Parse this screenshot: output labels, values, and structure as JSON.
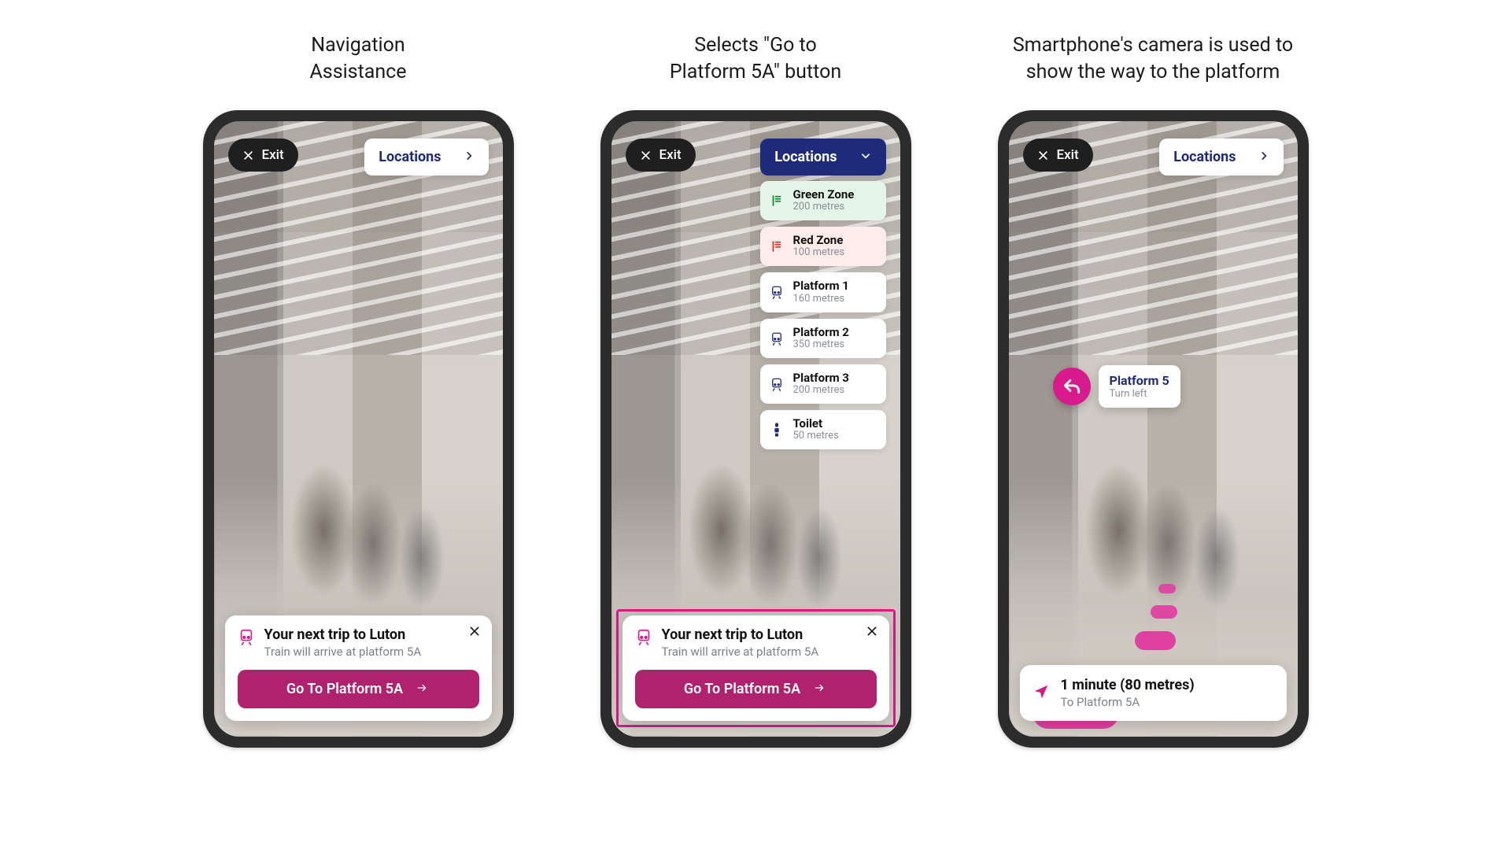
{
  "captions": {
    "c1": "Navigation\nAssistance",
    "c2": "Selects \"Go to\nPlatform 5A\" button",
    "c3": "Smartphone's camera is used to\nshow the way to the platform"
  },
  "top": {
    "exit": "Exit",
    "locations": "Locations"
  },
  "trip": {
    "title": "Your next trip to Luton",
    "subtitle": "Train will arrive at platform 5A",
    "go_label": "Go To Platform 5A"
  },
  "dropdown": [
    {
      "label": "Green Zone",
      "dist": "200 metres",
      "variant": "green",
      "icon": "zone"
    },
    {
      "label": "Red Zone",
      "dist": "100 metres",
      "variant": "red",
      "icon": "zone"
    },
    {
      "label": "Platform 1",
      "dist": "160 metres",
      "variant": "plain",
      "icon": "train"
    },
    {
      "label": "Platform 2",
      "dist": "350 metres",
      "variant": "plain",
      "icon": "train"
    },
    {
      "label": "Platform 3",
      "dist": "200 metres",
      "variant": "plain",
      "icon": "train"
    },
    {
      "label": "Toilet",
      "dist": "50 metres",
      "variant": "plain",
      "icon": "toilet"
    }
  ],
  "ar": {
    "callout_title": "Platform 5",
    "callout_sub": "Turn left",
    "nav_title": "1 minute (80 metres)",
    "nav_sub": "To Platform 5A"
  },
  "colors": {
    "brand_indigo": "#1f2a7a",
    "brand_magenta": "#d81b8c",
    "go_btn": "#b0216e"
  }
}
